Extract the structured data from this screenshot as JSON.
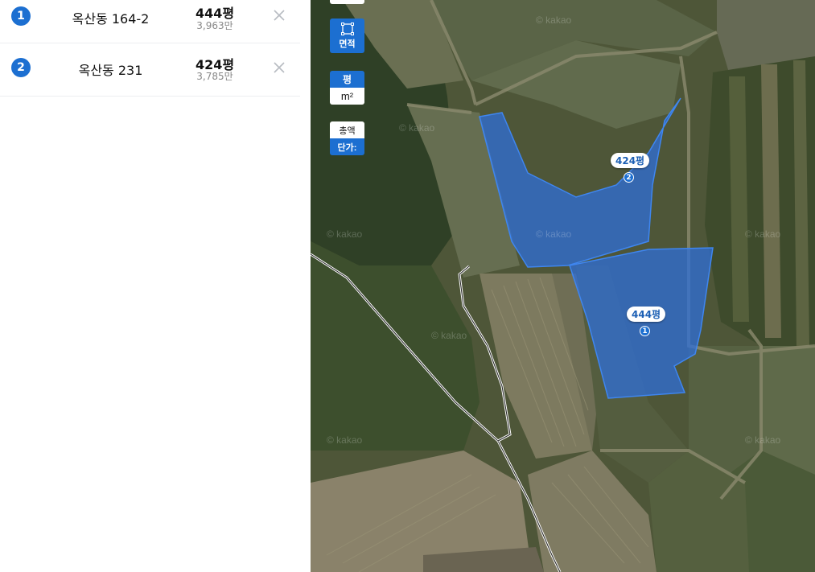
{
  "parcels": [
    {
      "num": "1",
      "address": "옥산동 164-2",
      "area": "444평",
      "price": "3,963만"
    },
    {
      "num": "2",
      "address": "옥산동 231",
      "area": "424평",
      "price": "3,785만"
    }
  ],
  "map": {
    "controls": {
      "area_btn_label": "면적",
      "unit_pyeong": "평",
      "unit_sqm": "m²",
      "total_label": "총액",
      "unit_price_label": "단가:"
    },
    "labels": [
      {
        "area": "424평",
        "num": "2"
      },
      {
        "area": "444평",
        "num": "1"
      }
    ],
    "watermark": "© kakao"
  },
  "colors": {
    "accent": "#1c6fd1",
    "parcel_fill": "#2f6fd8"
  },
  "icons": {
    "remove": "close-icon",
    "area_tool": "square-select-icon"
  }
}
